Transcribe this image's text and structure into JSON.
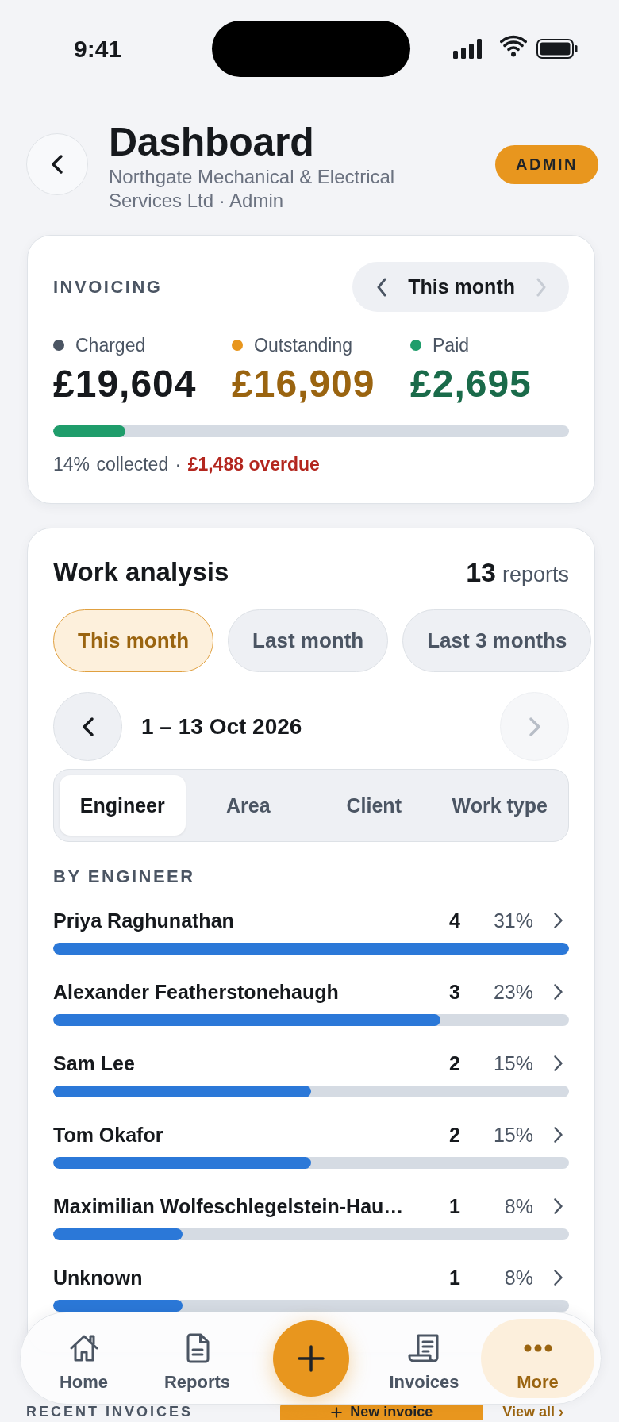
{
  "status_bar": {
    "time": "9:41"
  },
  "header": {
    "title": "Dashboard",
    "subtitle": "Northgate Mechanical & Electrical Services Ltd · Admin",
    "badge": "ADMIN"
  },
  "invoicing": {
    "title": "INVOICING",
    "period": "This month",
    "prev_disabled": false,
    "next_disabled": true,
    "stats": [
      {
        "label": "Charged",
        "value": "£19,604",
        "color": "#4b5563",
        "kind": "neutral"
      },
      {
        "label": "Outstanding",
        "value": "£16,909",
        "color": "#e8961e",
        "kind": "warning"
      },
      {
        "label": "Paid",
        "value": "£2,695",
        "color": "#1f9d6b",
        "kind": "success"
      }
    ],
    "progress": {
      "level": 0.14
    },
    "summary": "14% collected · **£1,488 overdue**"
  },
  "work_analysis": {
    "title": "Work analysis",
    "count": "13",
    "count_unit": "reports",
    "ranges": [
      {
        "label": "This month",
        "selected": true
      },
      {
        "label": "Last month",
        "selected": false
      },
      {
        "label": "Last 3 months",
        "selected": false
      }
    ],
    "date_range": "1 – 13 Oct 2026",
    "prev_disabled": false,
    "next_disabled": true,
    "tabs": [
      {
        "label": "Engineer",
        "selected": true
      },
      {
        "label": "Area",
        "selected": false
      },
      {
        "label": "Client",
        "selected": false
      },
      {
        "label": "Work type",
        "selected": false
      }
    ],
    "section_title": "BY ENGINEER",
    "rows": [
      {
        "name": "Priya Raghunathan",
        "count": "4",
        "percent": "31%",
        "level": 1.0
      },
      {
        "name": "Alexander Featherstonehaugh",
        "count": "3",
        "percent": "23%",
        "level": 0.75
      },
      {
        "name": "Sam Lee",
        "count": "2",
        "percent": "15%",
        "level": 0.5
      },
      {
        "name": "Tom Okafor",
        "count": "2",
        "percent": "15%",
        "level": 0.5
      },
      {
        "name": "Maximilian Wolfeschlegelstein-Hau…",
        "count": "1",
        "percent": "8%",
        "level": 0.25
      },
      {
        "name": "Unknown",
        "count": "1",
        "percent": "8%",
        "level": 0.25
      }
    ]
  },
  "recent_invoices": {
    "title": "RECENT INVOICES",
    "new_button": "New invoice",
    "view_all": "View all ›"
  },
  "bottom_nav": [
    {
      "kind": "tab",
      "label": "Home",
      "selected": false
    },
    {
      "kind": "tab",
      "label": "Reports",
      "selected": false
    },
    {
      "kind": "add"
    },
    {
      "kind": "tab",
      "label": "Invoices",
      "selected": false
    },
    {
      "kind": "tab",
      "label": "More",
      "selected": true
    }
  ]
}
